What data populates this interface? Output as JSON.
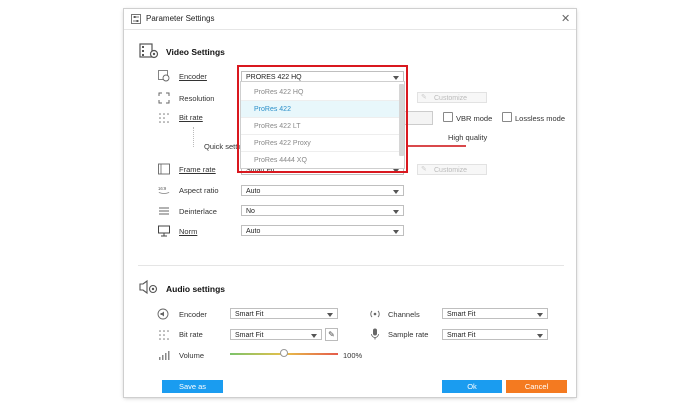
{
  "window": {
    "title": "Parameter Settings",
    "close_glyph": "✕"
  },
  "video": {
    "title": "Video Settings",
    "encoder": {
      "label": "Encoder",
      "value": "PRORES 422 HQ",
      "options": [
        "ProRes 422 HQ",
        "ProRes 422",
        "ProRes 422 LT",
        "ProRes 422 Proxy",
        "ProRes 4444 XQ"
      ],
      "highlighted": "ProRes 422"
    },
    "resolution": {
      "label": "Resolution",
      "customize": "Customize"
    },
    "bitrate": {
      "label": "Bit rate",
      "suffix": "le",
      "vbr_label": "VBR mode",
      "lossless_label": "Lossless mode",
      "quality_label": "High quality",
      "quick_setting": "Quick settin"
    },
    "framerate": {
      "label": "Frame rate",
      "value": "Smart Fit",
      "customize": "Customize"
    },
    "aspect": {
      "label": "Aspect ratio",
      "value": "Auto"
    },
    "deinterlace": {
      "label": "Deinterlace",
      "value": "No"
    },
    "norm": {
      "label": "Norm",
      "value": "Auto"
    }
  },
  "audio": {
    "title": "Audio settings",
    "encoder": {
      "label": "Encoder",
      "value": "Smart Fit"
    },
    "bitrate": {
      "label": "Bit rate",
      "value": "Smart Fit"
    },
    "volume": {
      "label": "Volume",
      "value": "100%",
      "level": 0.5
    },
    "channels": {
      "label": "Channels",
      "value": "Smart Fit"
    },
    "samplerate": {
      "label": "Sample rate",
      "value": "Smart Fit"
    }
  },
  "footer": {
    "save_as": "Save as",
    "ok": "Ok",
    "cancel": "Cancel"
  },
  "colors": {
    "save_btn": "#1a9cf0",
    "ok_btn": "#1a9cf0",
    "cancel_btn": "#f47a20",
    "highlight_frame": "#d9181f"
  }
}
